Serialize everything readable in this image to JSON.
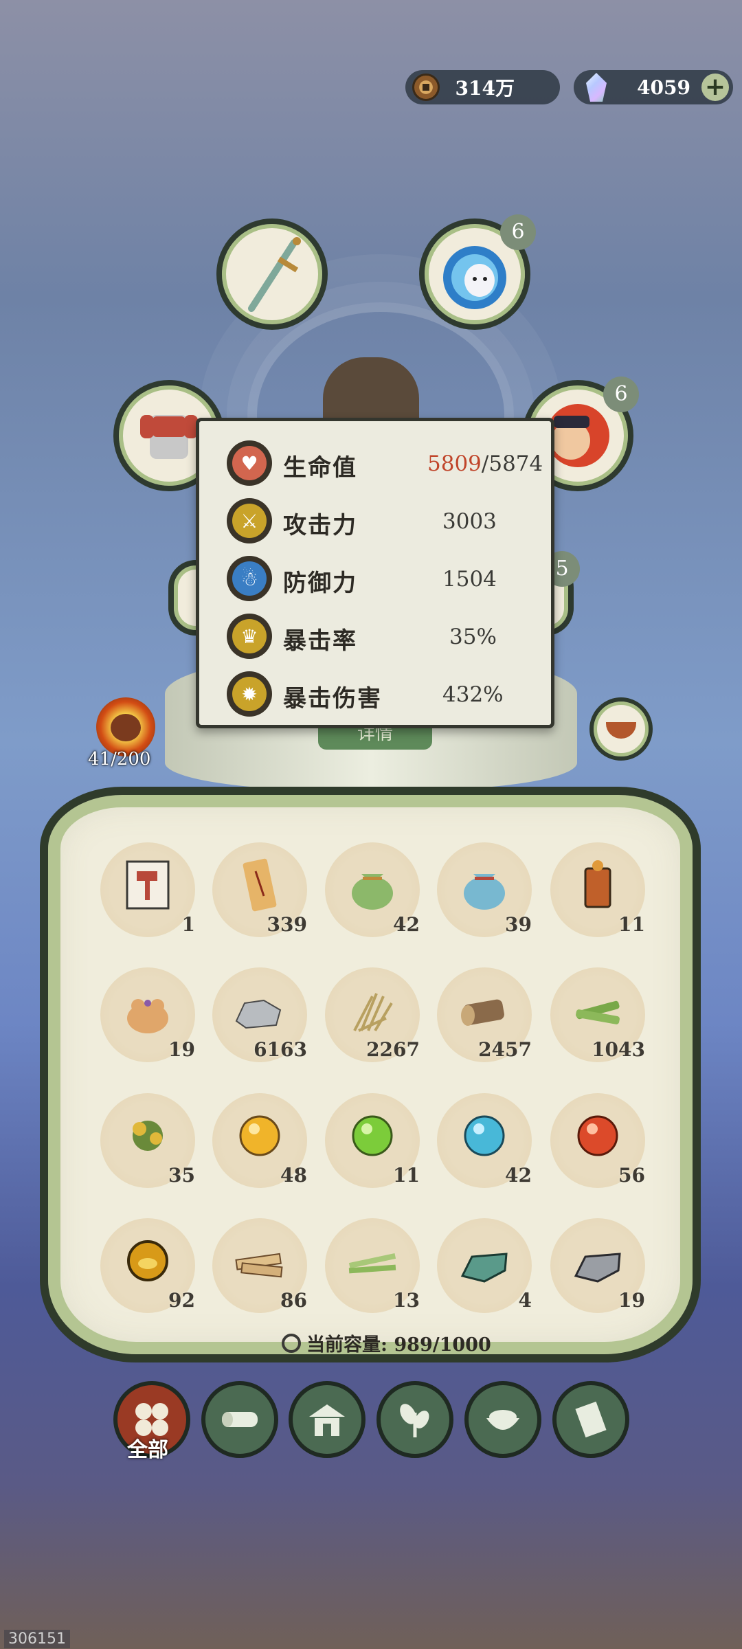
{
  "currency": {
    "coins": "314万",
    "gems": "4059",
    "add_label": "+"
  },
  "equipment": {
    "slots": [
      {
        "name": "sword",
        "badge": ""
      },
      {
        "name": "spirit",
        "badge": "6"
      },
      {
        "name": "armor",
        "badge": ""
      },
      {
        "name": "companion",
        "badge": "6"
      }
    ],
    "partial_badge": "5",
    "details_label": "详情"
  },
  "stats": [
    {
      "label": "生命值",
      "current": "5809",
      "max": "/5874",
      "icon": "heart-icon",
      "color": "#d2664f"
    },
    {
      "label": "攻击力",
      "value": "3003",
      "icon": "sword-icon",
      "color": "#c9a32a"
    },
    {
      "label": "防御力",
      "value": "1504",
      "icon": "person-icon",
      "color": "#3a7ec4"
    },
    {
      "label": "暴击率",
      "value": "35%",
      "icon": "crown-icon",
      "color": "#c9a32a"
    },
    {
      "label": "暴击伤害",
      "value": "432%",
      "icon": "burst-icon",
      "color": "#c9a32a"
    }
  ],
  "rage": {
    "count": "41/200"
  },
  "inventory": {
    "items": [
      {
        "icon": "hammer-scroll-icon",
        "qty": "1"
      },
      {
        "icon": "paper-scroll-icon",
        "qty": "339"
      },
      {
        "icon": "green-pouch-icon",
        "qty": "42"
      },
      {
        "icon": "blue-pouch-icon",
        "qty": "39"
      },
      {
        "icon": "token-icon",
        "qty": "11"
      },
      {
        "icon": "orange-pouch-icon",
        "qty": "19"
      },
      {
        "icon": "stone-icon",
        "qty": "6163"
      },
      {
        "icon": "grass-icon",
        "qty": "2267"
      },
      {
        "icon": "log-icon",
        "qty": "2457"
      },
      {
        "icon": "bamboo-icon",
        "qty": "1043"
      },
      {
        "icon": "herb-icon",
        "qty": "35"
      },
      {
        "icon": "gold-orb-icon",
        "qty": "48"
      },
      {
        "icon": "green-orb-icon",
        "qty": "11"
      },
      {
        "icon": "blue-orb-icon",
        "qty": "42"
      },
      {
        "icon": "red-orb-icon",
        "qty": "56"
      },
      {
        "icon": "amber-orb-icon",
        "qty": "92"
      },
      {
        "icon": "plank-icon",
        "qty": "86"
      },
      {
        "icon": "bamboo-strip-icon",
        "qty": "13"
      },
      {
        "icon": "jade-ingot-icon",
        "qty": "4"
      },
      {
        "icon": "iron-ingot-icon",
        "qty": "19"
      }
    ],
    "capacity": "当前容量: 989/1000"
  },
  "tabs": [
    {
      "icon": "all-icon",
      "label": "全部",
      "active": true
    },
    {
      "icon": "log-icon",
      "label": ""
    },
    {
      "icon": "house-icon",
      "label": ""
    },
    {
      "icon": "leaf-icon",
      "label": ""
    },
    {
      "icon": "bowl-icon",
      "label": ""
    },
    {
      "icon": "scroll-icon",
      "label": ""
    }
  ],
  "footer_id": "306151",
  "colors": {
    "orb_gold": "#f0b42a",
    "orb_green": "#7ccc3a",
    "orb_blue": "#48b8d8",
    "orb_red": "#dc4a2a",
    "orb_amber": "#d89a18"
  }
}
